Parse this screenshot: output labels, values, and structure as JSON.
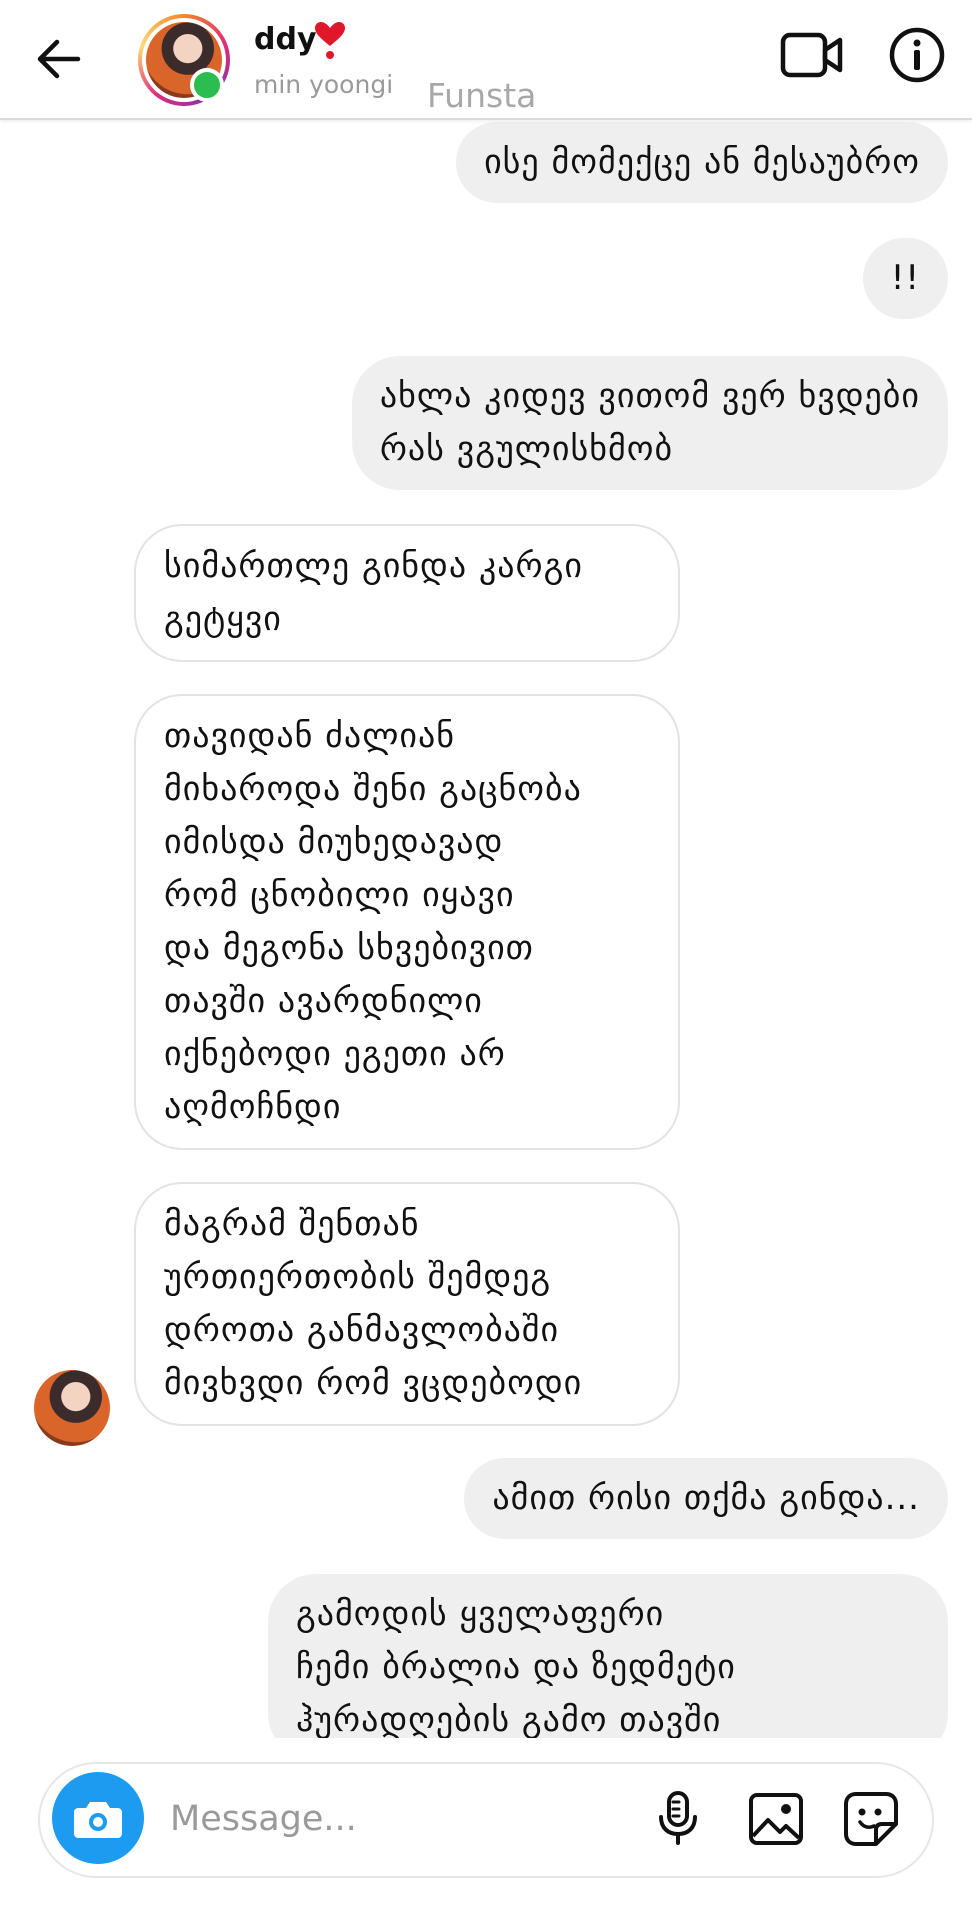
{
  "header": {
    "name": "ddy",
    "username": "min yoongi",
    "watermark": "Funsta"
  },
  "messages": [
    {
      "from": "me",
      "text": "ისე მომექცე ან მესაუბრო"
    },
    {
      "from": "me",
      "text": "!!"
    },
    {
      "from": "me",
      "text": "ახლა კიდევ ვითომ ვერ ხვდები\nრას ვგულისხმობ"
    },
    {
      "from": "them",
      "text": "სიმართლე გინდა კარგი\nგეტყვი"
    },
    {
      "from": "them",
      "text": "თავიდან ძალიან\nმიხაროდა შენი გაცნობა\nიმისდა მიუხედავად\nრომ ცნობილი იყავი\nდა მეგონა სხვებივით\nთავში ავარდნილი\nიქნებოდი ეგეთი არ\nაღმოჩნდი"
    },
    {
      "from": "them",
      "text": "მაგრამ შენთან\nურთიერთობის შემდეგ\nდროთა განმავლობაში\nმივხვდი რომ ვცდებოდი"
    },
    {
      "from": "me",
      "text": "ამით რისი თქმა გინდა..."
    },
    {
      "from": "me",
      "text": "გამოდის ყველაფერი\nჩემი ბრალია და ზედმეტი\nჰურადღების გამო თავში"
    }
  ],
  "composer": {
    "placeholder": "Message..."
  },
  "icons": {
    "back": "arrow-left-icon",
    "heart": "heart-exclamation-icon",
    "video": "video-camera-icon",
    "info": "info-icon",
    "camera": "camera-icon",
    "mic": "microphone-icon",
    "gallery": "image-icon",
    "sticker": "sticker-icon"
  },
  "colors": {
    "accent": "#1c9bf0",
    "online": "#2bbd4f",
    "heart": "#e0162b",
    "outgoing_bubble": "#efefef"
  }
}
